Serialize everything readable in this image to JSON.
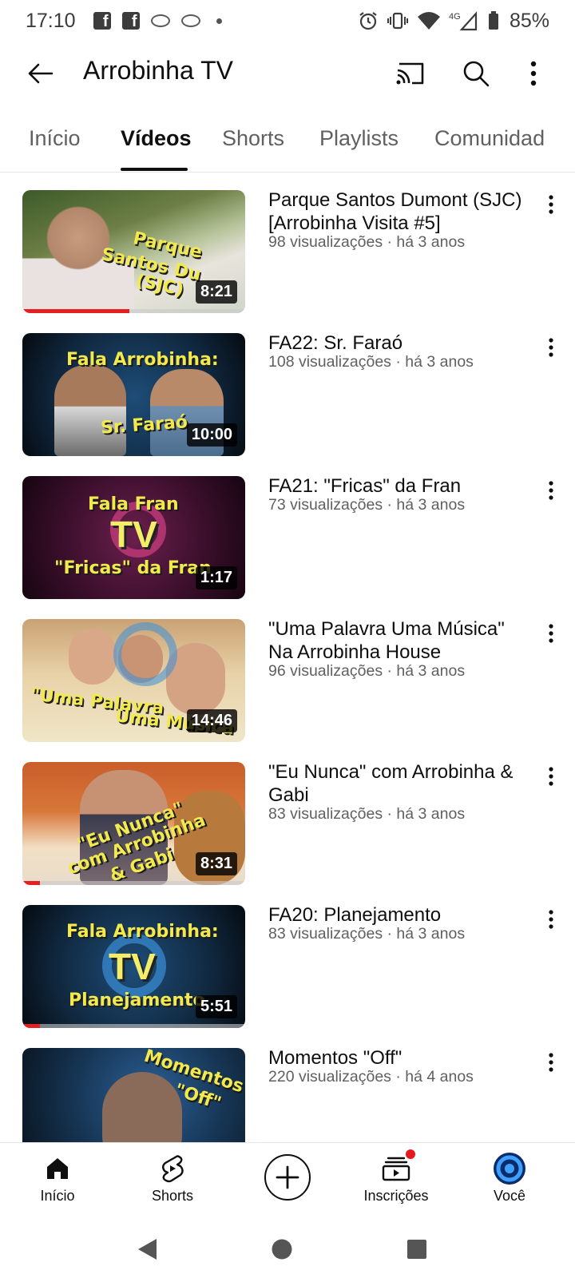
{
  "status_bar": {
    "time": "17:10",
    "network": "4G",
    "battery": "85%"
  },
  "header": {
    "channel_title": "Arrobinha TV",
    "icons": [
      "back-arrow-icon",
      "cast-icon",
      "search-icon",
      "more-vert-icon"
    ]
  },
  "tabs": [
    {
      "label": "Início"
    },
    {
      "label": "Vídeos",
      "active": true
    },
    {
      "label": "Shorts"
    },
    {
      "label": "Playlists"
    },
    {
      "label": "Comunidad"
    }
  ],
  "videos": [
    {
      "title": "Parque Santos Dumont (SJC) [Arrobinha Visita #5]",
      "meta": "98 visualizações · há 3 anos",
      "duration": "8:21",
      "watched_fraction": 0.48,
      "thumb_text": [
        "Parque",
        "Santos Du",
        "(SJC)"
      ]
    },
    {
      "title": "FA22: Sr. Faraó",
      "meta": "108 visualizações · há 3 anos",
      "duration": "10:00",
      "watched_fraction": 0,
      "thumb_text": [
        "Fala Arrobinha:",
        "Sr. Faraó"
      ]
    },
    {
      "title": "FA21: \"Fricas\" da Fran",
      "meta": "73 visualizações · há 3 anos",
      "duration": "1:17",
      "watched_fraction": 0,
      "thumb_text": [
        "Fala Fran",
        "TV",
        "\"Fricas\" da Fran"
      ]
    },
    {
      "title": "\"Uma Palavra Uma Música\" Na Arrobinha House",
      "meta": "96 visualizações · há 3 anos",
      "duration": "14:46",
      "watched_fraction": 0,
      "thumb_text": [
        "\"Uma Palavra",
        "Uma Música"
      ]
    },
    {
      "title": "\"Eu Nunca\" com Arrobinha & Gabi",
      "meta": "83 visualizações · há 3 anos",
      "duration": "8:31",
      "watched_fraction": 0.08,
      "thumb_text": [
        "\"Eu Nunca\"",
        "com Arrobinha",
        "& Gabi"
      ]
    },
    {
      "title": "FA20: Planejamento",
      "meta": "83 visualizações · há 3 anos",
      "duration": "5:51",
      "watched_fraction": 0.08,
      "thumb_text": [
        "Fala Arrobinha:",
        "TV",
        "Planejamento"
      ]
    },
    {
      "title": "Momentos \"Off\"",
      "meta": "220 visualizações · há 4 anos",
      "duration": "",
      "watched_fraction": 0,
      "thumb_text": [
        "Momentos",
        "\"Off\""
      ]
    }
  ],
  "bottom_nav": [
    {
      "label": "Início",
      "icon": "home-icon"
    },
    {
      "label": "Shorts",
      "icon": "shorts-icon"
    },
    {
      "label": "",
      "icon": "create-plus-icon"
    },
    {
      "label": "Inscrições",
      "icon": "subscriptions-icon"
    },
    {
      "label": "Você",
      "icon": "avatar-icon"
    }
  ],
  "colors": {
    "accent_red": "#e52020",
    "text_primary": "#0f0f0f",
    "text_secondary": "#606060"
  }
}
